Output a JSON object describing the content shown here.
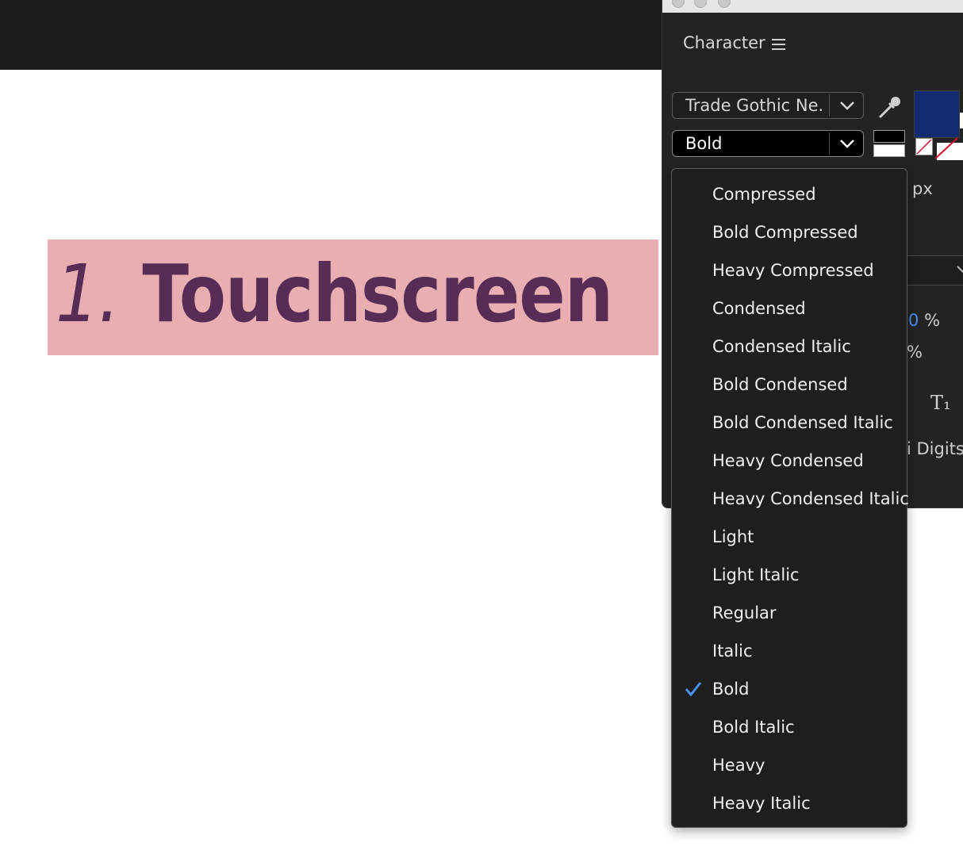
{
  "canvas": {
    "headline_number": "1.",
    "headline_word": "Touchscreen"
  },
  "panel": {
    "title": "Character",
    "font_family": "Trade Gothic Ne...",
    "font_style": "Bold",
    "fill_color": "#122c6f",
    "partial_labels": {
      "unit": "px",
      "percent_1_value": "0",
      "percent_1_unit": "%",
      "percent_2_unit": "%",
      "subscript_symbol": "T₁",
      "digits_label": "i Digits"
    }
  },
  "menu": {
    "items": [
      {
        "label": "Compressed",
        "checked": false
      },
      {
        "label": "Bold Compressed",
        "checked": false
      },
      {
        "label": "Heavy Compressed",
        "checked": false
      },
      {
        "label": "Condensed",
        "checked": false
      },
      {
        "label": "Condensed Italic",
        "checked": false
      },
      {
        "label": "Bold Condensed",
        "checked": false
      },
      {
        "label": "Bold Condensed Italic",
        "checked": false
      },
      {
        "label": "Heavy Condensed",
        "checked": false
      },
      {
        "label": "Heavy Condensed Italic",
        "checked": false
      },
      {
        "label": "Light",
        "checked": false
      },
      {
        "label": "Light Italic",
        "checked": false
      },
      {
        "label": "Regular",
        "checked": false
      },
      {
        "label": "Italic",
        "checked": false
      },
      {
        "label": "Bold",
        "checked": true
      },
      {
        "label": "Bold Italic",
        "checked": false
      },
      {
        "label": "Heavy",
        "checked": false
      },
      {
        "label": "Heavy Italic",
        "checked": false
      }
    ],
    "check_color": "#4a90e8"
  }
}
